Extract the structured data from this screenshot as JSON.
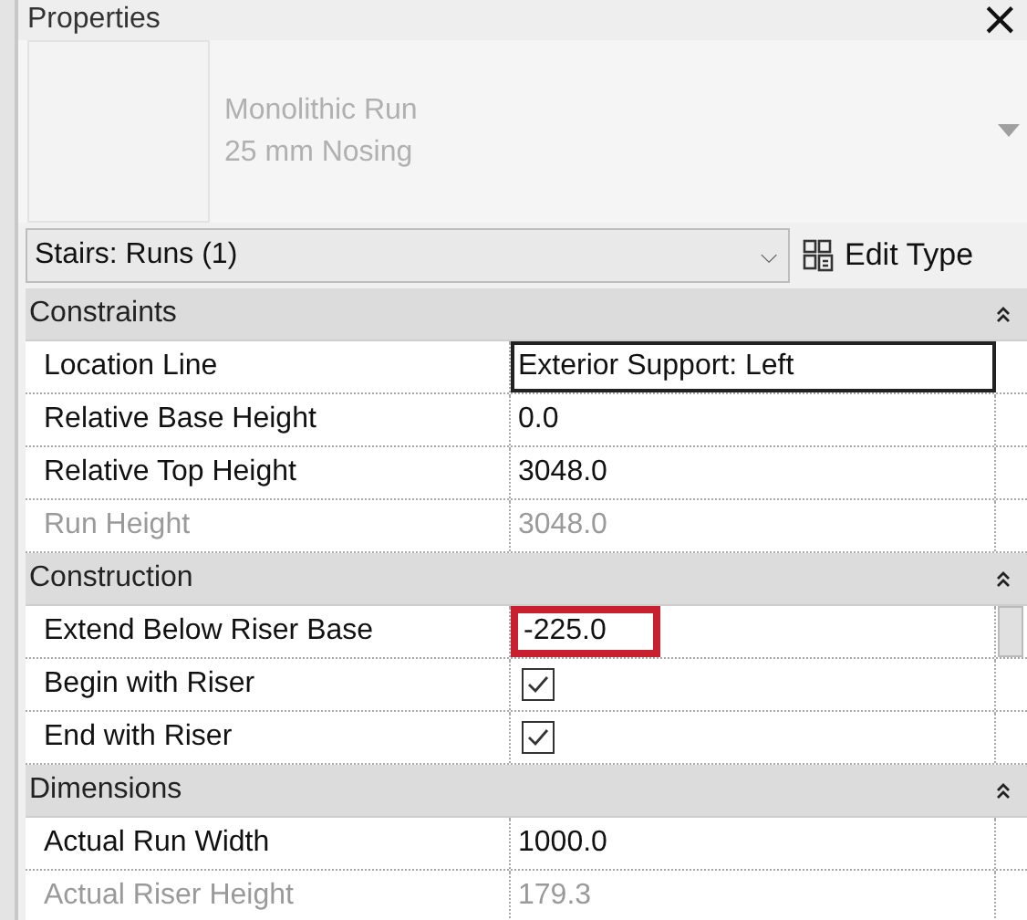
{
  "panel": {
    "title": "Properties",
    "close": "×"
  },
  "type_selector": {
    "lines": [
      "Monolithic Run",
      "25 mm Nosing"
    ]
  },
  "filter": {
    "value": "Stairs: Runs (1)",
    "caret": "⌵"
  },
  "edit_type": {
    "label": "Edit Type"
  },
  "sections": [
    {
      "name": "Constraints",
      "expanded": true,
      "rows": [
        {
          "label": "Location Line",
          "kind": "text",
          "value": "Exterior Support: Left",
          "disabled": false,
          "editing": true,
          "highlighted": false
        },
        {
          "label": "Relative Base Height",
          "kind": "text",
          "value": "0.0",
          "disabled": false,
          "editing": false,
          "highlighted": false
        },
        {
          "label": "Relative Top Height",
          "kind": "text",
          "value": "3048.0",
          "disabled": false,
          "editing": false,
          "highlighted": false
        },
        {
          "label": "Run Height",
          "kind": "text",
          "value": "3048.0",
          "disabled": true,
          "editing": false,
          "highlighted": false
        }
      ]
    },
    {
      "name": "Construction",
      "expanded": true,
      "rows": [
        {
          "label": "Extend Below Riser Base",
          "kind": "text",
          "value": "-225.0",
          "disabled": false,
          "editing": false,
          "highlighted": true
        },
        {
          "label": "Begin with Riser",
          "kind": "check",
          "checked": true,
          "disabled": false
        },
        {
          "label": "End with Riser",
          "kind": "check",
          "checked": true,
          "disabled": false
        }
      ]
    },
    {
      "name": "Dimensions",
      "expanded": true,
      "rows": [
        {
          "label": "Actual Run Width",
          "kind": "text",
          "value": "1000.0",
          "disabled": false,
          "editing": false,
          "highlighted": false
        },
        {
          "label": "Actual Riser Height",
          "kind": "text",
          "value": "179.3",
          "disabled": true,
          "editing": false,
          "highlighted": false
        }
      ]
    }
  ]
}
